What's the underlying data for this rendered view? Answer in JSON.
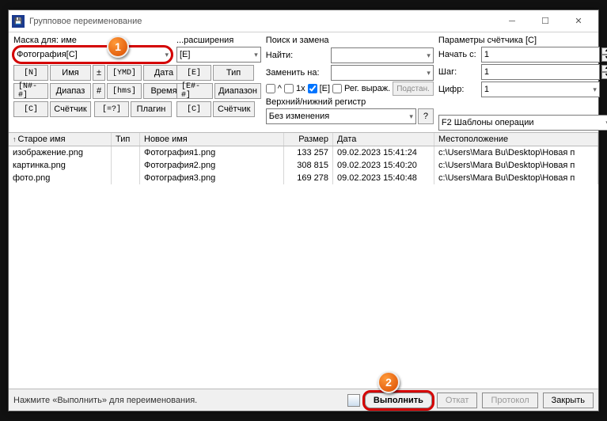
{
  "titlebar": {
    "title": "Групповое переименование"
  },
  "colA": {
    "label": "Маска для: име",
    "combo_value": "Фотография[C]",
    "r1": {
      "b1": "[N]",
      "b2": "Имя",
      "b3": "[YMD]",
      "b4": "Дата"
    },
    "r2": {
      "b1": "[N#-#]",
      "b2": "Диапаз",
      "b3": "[hms]",
      "b4": "Время"
    },
    "r3": {
      "b1": "[C]",
      "b2": "Счётчик",
      "b3": "[=?]",
      "b4": "Плагин"
    },
    "plusminus": "±"
  },
  "colB": {
    "label": "...расширения",
    "combo_value": "[E]",
    "r1": {
      "b1": "[E]",
      "b2": "Тип"
    },
    "r2": {
      "b1": "[E#-#]",
      "b2": "Диапазон"
    },
    "r3": {
      "b1": "[C]",
      "b2": "Счётчик"
    }
  },
  "colC": {
    "label": "Поиск и замена",
    "find_label": "Найти:",
    "replace_label": "Заменить на:",
    "chk_up": "^",
    "chk_1x": "1x",
    "chk_e": "[E]",
    "chk_regex": "Рег. выраж.",
    "btn_subst": "Подстан.",
    "case_label": "Верхний/нижний регистр",
    "case_value": "Без изменения"
  },
  "colD": {
    "label": "Параметры счётчика [C]",
    "start_label": "Начать с:",
    "start_value": "1",
    "step_label": "Шаг:",
    "step_value": "1",
    "digits_label": "Цифр:",
    "digits_value": "1",
    "question": "?",
    "templates": "F2 Шаблоны операции"
  },
  "list": {
    "headers": {
      "old": "Старое имя",
      "typ": "Тип",
      "new": "Новое имя",
      "size": "Размер",
      "date": "Дата",
      "loc": "Местоположение"
    },
    "rows": [
      {
        "old": "изображение.png",
        "typ": "",
        "new": "Фотография1.png",
        "size": "133 257",
        "date": "09.02.2023 15:41:24",
        "loc": "c:\\Users\\Mara Bu\\Desktop\\Новая п"
      },
      {
        "old": "картинка.png",
        "typ": "",
        "new": "Фотография2.png",
        "size": "308 815",
        "date": "09.02.2023 15:40:20",
        "loc": "c:\\Users\\Mara Bu\\Desktop\\Новая п"
      },
      {
        "old": "фото.png",
        "typ": "",
        "new": "Фотография3.png",
        "size": "169 278",
        "date": "09.02.2023 15:40:48",
        "loc": "c:\\Users\\Mara Bu\\Desktop\\Новая п"
      }
    ]
  },
  "footer": {
    "status": "Нажмите «Выполнить» для переименования.",
    "run": "Выполнить",
    "undo": "Откат",
    "log": "Протокол",
    "close": "Закрыть"
  },
  "anno": {
    "one": "1",
    "two": "2"
  }
}
